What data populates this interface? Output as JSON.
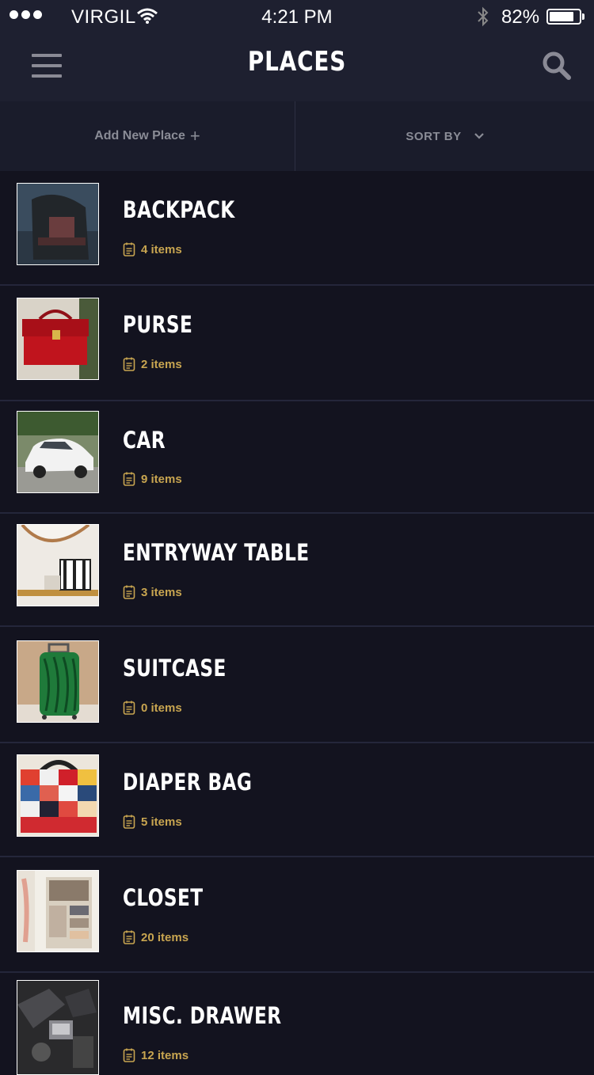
{
  "status_bar": {
    "carrier": "VIRGIL",
    "time": "4:21 PM",
    "battery_percent": "82%",
    "battery_level": 0.82,
    "icons": [
      "signal-dots-icon",
      "wifi-icon",
      "bluetooth-icon",
      "battery-icon"
    ]
  },
  "header": {
    "title": "PLACES",
    "menu_icon": "hamburger-menu-icon",
    "search_icon": "search-icon"
  },
  "actions": {
    "add_new_place_label": "Add New Place",
    "add_icon": "+",
    "sort_by_label": "SORT BY",
    "sort_icon": "chevron-down-icon"
  },
  "colors": {
    "background": "#13131f",
    "bar": "#1e2030",
    "accent_gold": "#c8a550",
    "muted_text": "#8a8c96"
  },
  "places": [
    {
      "name": "BACKPACK",
      "count": "4 items",
      "thumb": "backpack-photo"
    },
    {
      "name": "PURSE",
      "count": "2 items",
      "thumb": "purse-photo"
    },
    {
      "name": "CAR",
      "count": "9 items",
      "thumb": "car-photo"
    },
    {
      "name": "ENTRYWAY TABLE",
      "count": "3 items",
      "thumb": "entryway-table-photo"
    },
    {
      "name": "SUITCASE",
      "count": "0 items",
      "thumb": "suitcase-photo"
    },
    {
      "name": "DIAPER BAG",
      "count": "5 items",
      "thumb": "diaper-bag-photo"
    },
    {
      "name": "CLOSET",
      "count": "20 items",
      "thumb": "closet-photo"
    },
    {
      "name": "MISC. DRAWER",
      "count": "12 items",
      "thumb": "misc-drawer-photo"
    }
  ]
}
